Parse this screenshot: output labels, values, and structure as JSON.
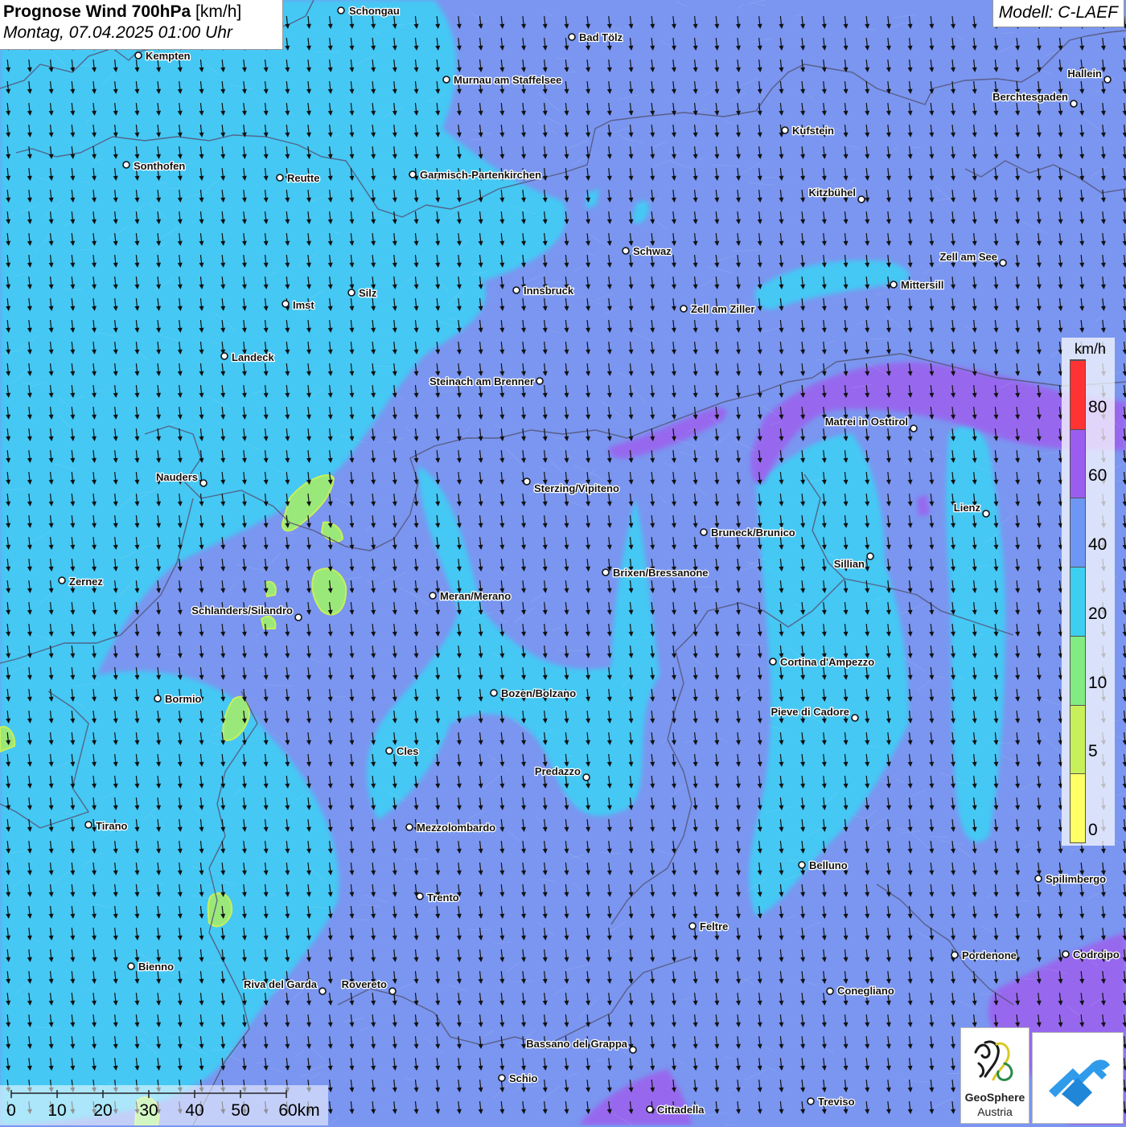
{
  "header": {
    "title_main": "Prognose Wind 700hPa",
    "title_unit": "[km/h]",
    "datetime": "Montag, 07.04.2025 01:00 Uhr",
    "model": "Modell: C-LAEF"
  },
  "legend": {
    "unit": "km/h",
    "ticks": [
      "0",
      "5",
      "10",
      "20",
      "40",
      "60",
      "80"
    ],
    "colors": [
      "#ffff66",
      "#c8f05a",
      "#82eb82",
      "#3ccff0",
      "#6e96f5",
      "#9b5cf0",
      "#ff3333"
    ]
  },
  "scale_bar": {
    "labels": [
      "0",
      "10",
      "20",
      "30",
      "40",
      "50",
      "60km"
    ]
  },
  "logos": {
    "geosphere_name": "GeoSphere",
    "geosphere_sub": "Austria"
  },
  "colors": {
    "light_wind": "#45c8f4",
    "medium_wind": "#7a96f0",
    "strong_wind": "#9966ee",
    "calm_wind": "#9ae87a"
  },
  "icons": {
    "wind_arrow": "arrow-down-icon",
    "city_marker": "circle-marker-icon"
  },
  "cities": [
    {
      "name": "Schongau",
      "dot": [
        424,
        13
      ],
      "lab": [
        434,
        18
      ],
      "anchor": "start"
    },
    {
      "name": "Bad Tölz",
      "dot": [
        711,
        46
      ],
      "lab": [
        720,
        51
      ],
      "anchor": "start"
    },
    {
      "name": "Kempten",
      "dot": [
        172,
        69
      ],
      "lab": [
        181,
        74
      ],
      "anchor": "start"
    },
    {
      "name": "Murnau am Staffelsee",
      "dot": [
        555,
        99
      ],
      "lab": [
        564,
        104
      ],
      "anchor": "start"
    },
    {
      "name": "Hallein",
      "dot": [
        1377,
        99
      ],
      "lab": [
        1370,
        96
      ],
      "anchor": "end"
    },
    {
      "name": "Berchtesgaden",
      "dot": [
        1335,
        129
      ],
      "lab": [
        1328,
        125
      ],
      "anchor": "end"
    },
    {
      "name": "Kufstein",
      "dot": [
        976,
        162
      ],
      "lab": [
        985,
        167
      ],
      "anchor": "start"
    },
    {
      "name": "Sonthofen",
      "dot": [
        157,
        205
      ],
      "lab": [
        166,
        211
      ],
      "anchor": "start"
    },
    {
      "name": "Garmisch-Partenkirchen",
      "dot": [
        513,
        217
      ],
      "lab": [
        522,
        222
      ],
      "anchor": "start"
    },
    {
      "name": "Reutte",
      "dot": [
        348,
        221
      ],
      "lab": [
        357,
        226
      ],
      "anchor": "start"
    },
    {
      "name": "Kitzbühel",
      "dot": [
        1071,
        248
      ],
      "lab": [
        1064,
        244
      ],
      "anchor": "end"
    },
    {
      "name": "Schwaz",
      "dot": [
        778,
        312
      ],
      "lab": [
        787,
        317
      ],
      "anchor": "start"
    },
    {
      "name": "Zell am See",
      "dot": [
        1247,
        327
      ],
      "lab": [
        1240,
        324
      ],
      "anchor": "end"
    },
    {
      "name": "Mittersill",
      "dot": [
        1111,
        354
      ],
      "lab": [
        1120,
        359
      ],
      "anchor": "start"
    },
    {
      "name": "Innsbruck",
      "dot": [
        642,
        361
      ],
      "lab": [
        651,
        366
      ],
      "anchor": "start"
    },
    {
      "name": "Silz",
      "dot": [
        437,
        364
      ],
      "lab": [
        446,
        369
      ],
      "anchor": "start"
    },
    {
      "name": "Imst",
      "dot": [
        355,
        378
      ],
      "lab": [
        364,
        384
      ],
      "anchor": "start"
    },
    {
      "name": "Zell am Ziller",
      "dot": [
        850,
        384
      ],
      "lab": [
        859,
        389
      ],
      "anchor": "start"
    },
    {
      "name": "Landeck",
      "dot": [
        279,
        443
      ],
      "lab": [
        288,
        449
      ],
      "anchor": "start"
    },
    {
      "name": "Steinach am Brenner",
      "dot": [
        671,
        474
      ],
      "lab": [
        664,
        479
      ],
      "anchor": "end"
    },
    {
      "name": "Matrei in Osttirol",
      "dot": [
        1136,
        533
      ],
      "lab": [
        1129,
        529
      ],
      "anchor": "end"
    },
    {
      "name": "Nauders",
      "dot": [
        253,
        601
      ],
      "lab": [
        246,
        598
      ],
      "anchor": "end"
    },
    {
      "name": "Sterzing/Vipiteno",
      "dot": [
        655,
        599
      ],
      "lab": [
        664,
        612
      ],
      "anchor": "start"
    },
    {
      "name": "Lienz",
      "dot": [
        1226,
        639
      ],
      "lab": [
        1219,
        636
      ],
      "anchor": "end"
    },
    {
      "name": "Bruneck/Brunico",
      "dot": [
        875,
        662
      ],
      "lab": [
        884,
        667
      ],
      "anchor": "start"
    },
    {
      "name": "Sillian",
      "dot": [
        1082,
        692
      ],
      "lab": [
        1075,
        706
      ],
      "anchor": "end"
    },
    {
      "name": "Brixen/Bressanone",
      "dot": [
        753,
        712
      ],
      "lab": [
        762,
        717
      ],
      "anchor": "start"
    },
    {
      "name": "Zernez",
      "dot": [
        77,
        722
      ],
      "lab": [
        86,
        728
      ],
      "anchor": "start"
    },
    {
      "name": "Meran/Merano",
      "dot": [
        538,
        741
      ],
      "lab": [
        547,
        746
      ],
      "anchor": "start"
    },
    {
      "name": "Schlanders/Silandro",
      "dot": [
        371,
        768
      ],
      "lab": [
        364,
        764
      ],
      "anchor": "end"
    },
    {
      "name": "Cortina d'Ampezzo",
      "dot": [
        961,
        823
      ],
      "lab": [
        970,
        828
      ],
      "anchor": "start"
    },
    {
      "name": "Bozen/Bolzano",
      "dot": [
        614,
        862
      ],
      "lab": [
        623,
        867
      ],
      "anchor": "start"
    },
    {
      "name": "Bormio",
      "dot": [
        196,
        869
      ],
      "lab": [
        205,
        874
      ],
      "anchor": "start"
    },
    {
      "name": "Pieve di Cadore",
      "dot": [
        1063,
        893
      ],
      "lab": [
        1056,
        890
      ],
      "anchor": "end"
    },
    {
      "name": "Cles",
      "dot": [
        484,
        934
      ],
      "lab": [
        493,
        939
      ],
      "anchor": "start"
    },
    {
      "name": "Predazzo",
      "dot": [
        729,
        967
      ],
      "lab": [
        722,
        964
      ],
      "anchor": "end"
    },
    {
      "name": "Tirano",
      "dot": [
        110,
        1026
      ],
      "lab": [
        119,
        1032
      ],
      "anchor": "start"
    },
    {
      "name": "Mezzolombardo",
      "dot": [
        509,
        1029
      ],
      "lab": [
        518,
        1034
      ],
      "anchor": "start"
    },
    {
      "name": "Belluno",
      "dot": [
        997,
        1076
      ],
      "lab": [
        1006,
        1081
      ],
      "anchor": "start"
    },
    {
      "name": "Spilimbergo",
      "dot": [
        1291,
        1093
      ],
      "lab": [
        1300,
        1098
      ],
      "anchor": "start"
    },
    {
      "name": "Trento",
      "dot": [
        522,
        1115
      ],
      "lab": [
        531,
        1121
      ],
      "anchor": "start"
    },
    {
      "name": "Feltre",
      "dot": [
        861,
        1152
      ],
      "lab": [
        870,
        1157
      ],
      "anchor": "start"
    },
    {
      "name": "Pordenone",
      "dot": [
        1187,
        1188
      ],
      "lab": [
        1196,
        1193
      ],
      "anchor": "start"
    },
    {
      "name": "Codroipo",
      "dot": [
        1325,
        1187
      ],
      "lab": [
        1334,
        1192
      ],
      "anchor": "start"
    },
    {
      "name": "Bienno",
      "dot": [
        163,
        1202
      ],
      "lab": [
        172,
        1207
      ],
      "anchor": "start"
    },
    {
      "name": "Riva del Garda",
      "dot": [
        401,
        1233
      ],
      "lab": [
        394,
        1229
      ],
      "anchor": "end"
    },
    {
      "name": "Rovereto",
      "dot": [
        488,
        1233
      ],
      "lab": [
        481,
        1229
      ],
      "anchor": "end"
    },
    {
      "name": "Conegliano",
      "dot": [
        1032,
        1233
      ],
      "lab": [
        1041,
        1237
      ],
      "anchor": "start"
    },
    {
      "name": "Bassano del Grappa",
      "dot": [
        787,
        1306
      ],
      "lab": [
        780,
        1303
      ],
      "anchor": "end"
    },
    {
      "name": "Schio",
      "dot": [
        624,
        1341
      ],
      "lab": [
        633,
        1346
      ],
      "anchor": "start"
    },
    {
      "name": "Treviso",
      "dot": [
        1008,
        1370
      ],
      "lab": [
        1017,
        1375
      ],
      "anchor": "start"
    },
    {
      "name": "Cittadella",
      "dot": [
        808,
        1380
      ],
      "lab": [
        817,
        1385
      ],
      "anchor": "start"
    }
  ]
}
